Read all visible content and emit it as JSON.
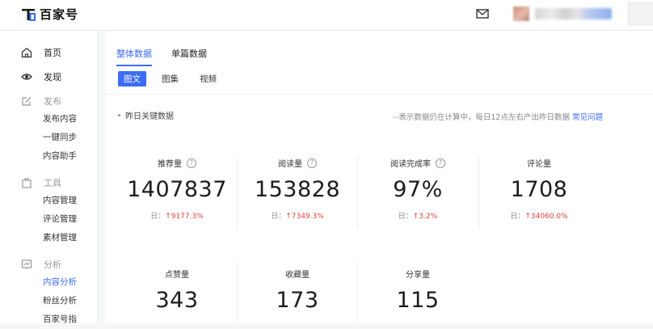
{
  "header": {
    "logo_text": "百家号",
    "icons": [
      "baijiahao-logo-icon",
      "mail-icon"
    ]
  },
  "sidebar": {
    "groups": [
      {
        "label": "首页",
        "icon": "home-icon"
      },
      {
        "label": "发现",
        "icon": "eye-icon"
      },
      {
        "label": "发布",
        "icon": "edit-icon",
        "items": [
          "发布内容",
          "一键同步",
          "内容助手"
        ]
      },
      {
        "label": "工具",
        "icon": "bag-icon",
        "items": [
          "内容管理",
          "评论管理",
          "素材管理"
        ]
      },
      {
        "label": "分析",
        "icon": "chart-icon",
        "items": [
          "内容分析",
          "粉丝分析",
          "百家号指"
        ]
      }
    ],
    "active_item": "内容分析"
  },
  "main": {
    "tabs": [
      "整体数据",
      "单篇数据"
    ],
    "active_tab": "整体数据",
    "subtabs": [
      "图文",
      "图集",
      "视频"
    ],
    "active_subtab": "图文",
    "section_title": "昨日关键数据",
    "note": "--表示数据仍在计算中，每日12点左右产出昨日数据",
    "note_link": "常见问题",
    "day_prefix": "日：",
    "metrics": [
      {
        "label": "推荐量",
        "value": "1407837",
        "change": "↑9177.3%",
        "help": true
      },
      {
        "label": "阅读量",
        "value": "153828",
        "change": "↑7349.3%",
        "help": true
      },
      {
        "label": "阅读完成率",
        "value": "97%",
        "change": "↑3.2%",
        "help": true
      },
      {
        "label": "评论量",
        "value": "1708",
        "change": "↑34060.0%",
        "help": false
      },
      {
        "label": "点赞量",
        "value": "343",
        "help": false
      },
      {
        "label": "收藏量",
        "value": "173",
        "help": false
      },
      {
        "label": "分享量",
        "value": "115",
        "help": false
      }
    ]
  },
  "colors": {
    "accent": "#3b6cf5",
    "increase": "#e0413c"
  }
}
